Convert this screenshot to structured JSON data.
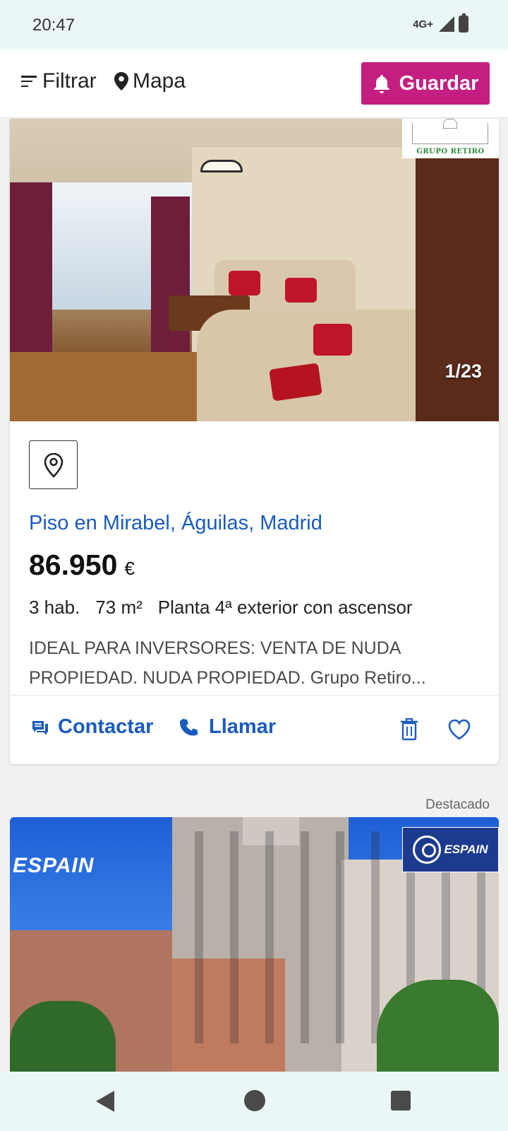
{
  "status_bar": {
    "time": "20:47",
    "network": "4G+",
    "icons": [
      "signal-icon",
      "battery-icon"
    ]
  },
  "top_bar": {
    "filter_label": "Filtrar",
    "map_label": "Mapa",
    "save_label": "Guardar",
    "save_color": "#c41e80"
  },
  "listing": {
    "photo_counter": "1/23",
    "agency_logo_text": "GRUPO RETIRO",
    "title": "Piso en Mirabel, Águilas, Madrid",
    "price": "86.950",
    "currency": "€",
    "features": {
      "rooms": "3 hab.",
      "area": "73 m²",
      "floor": "Planta 4ª exterior con ascensor"
    },
    "description": "IDEAL PARA INVERSORES: VENTA DE NUDA PROPIEDAD. NUDA PROPIEDAD. Grupo Retiro...",
    "actions": {
      "contact_label": "Contactar",
      "call_label": "Llamar"
    },
    "accent_color": "#1a5bbf"
  },
  "featured": {
    "label": "Destacado",
    "watermark_text": "ESPAIN",
    "agency_logo_text": "ESPAIN"
  }
}
